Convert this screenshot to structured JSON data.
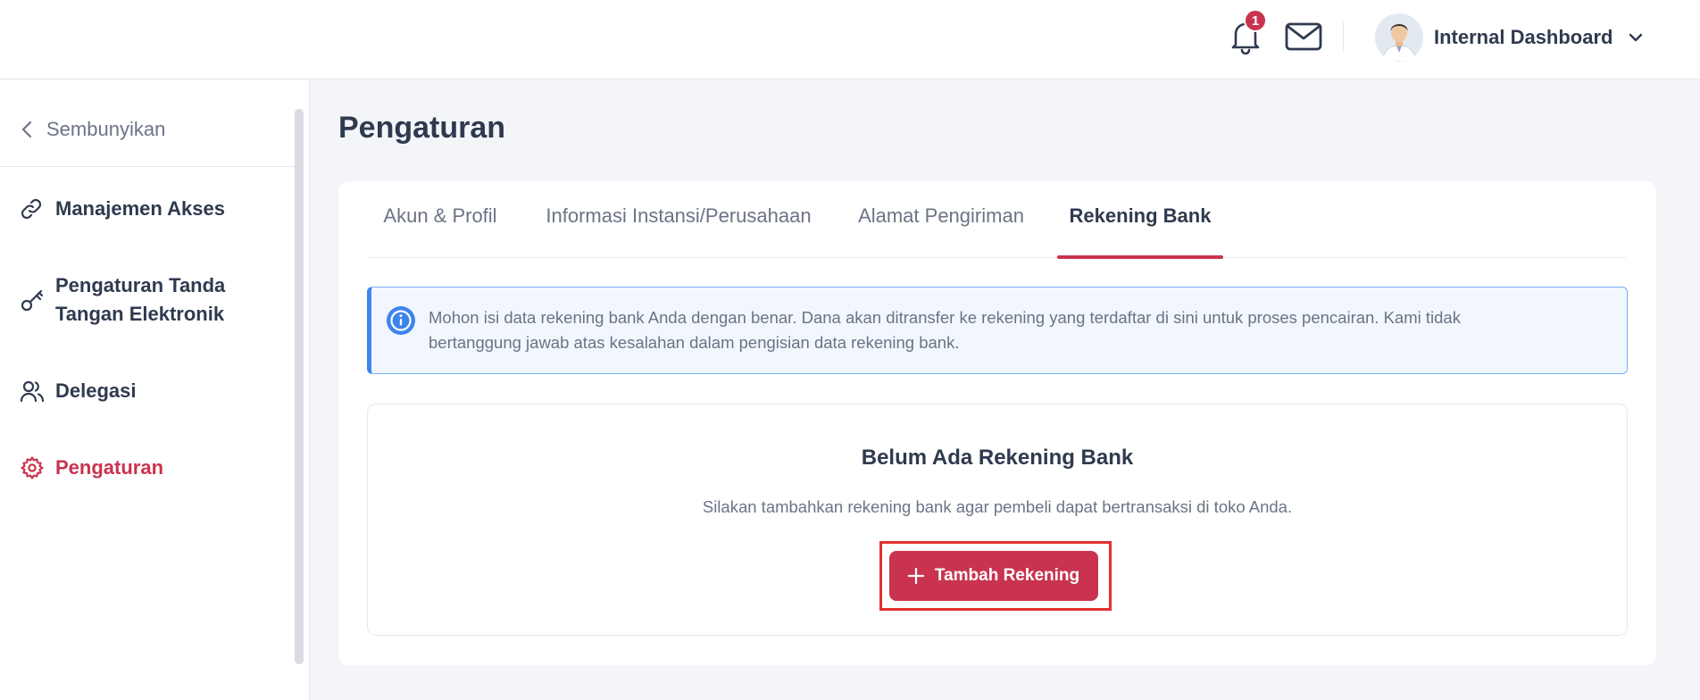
{
  "header": {
    "notification_count": "1",
    "user_name": "Internal Dashboard",
    "icons": [
      "bell-icon",
      "mail-icon",
      "avatar",
      "chevron-down-icon"
    ]
  },
  "sidebar": {
    "hide_label": "Sembunyikan",
    "items": [
      {
        "label": "Manajemen Akses",
        "icon": "link-icon"
      },
      {
        "label": "Pengaturan Tanda Tangan Elektronik",
        "line1": "Pengaturan Tanda",
        "line2": "Tangan Elektronik",
        "icon": "key-icon"
      },
      {
        "label": "Delegasi",
        "icon": "users-icon"
      },
      {
        "label": "Pengaturan",
        "icon": "gear-icon",
        "active": true
      }
    ]
  },
  "main": {
    "title": "Pengaturan",
    "tabs": [
      {
        "label": "Akun & Profil"
      },
      {
        "label": "Informasi Instansi/Perusahaan"
      },
      {
        "label": "Alamat Pengiriman"
      },
      {
        "label": "Rekening Bank",
        "active": true
      }
    ],
    "alert": {
      "line1": "Mohon isi data rekening bank Anda dengan benar. Dana akan ditransfer ke rekening yang terdaftar di sini untuk proses pencairan. Kami tidak",
      "line2": "bertanggung jawab atas kesalahan dalam pengisian data rekening bank."
    },
    "empty_state": {
      "title": "Belum Ada Rekening Bank",
      "description": "Silakan tambahkan rekening bank agar pembeli dapat bertransaksi di toko Anda.",
      "button_label": "Tambah Rekening"
    }
  },
  "colors": {
    "accent": "#c9334f",
    "info_border": "#3c85ee",
    "info_bg": "#f2f7fe",
    "highlight": "#e23030",
    "page_bg": "#f4f5f9"
  }
}
